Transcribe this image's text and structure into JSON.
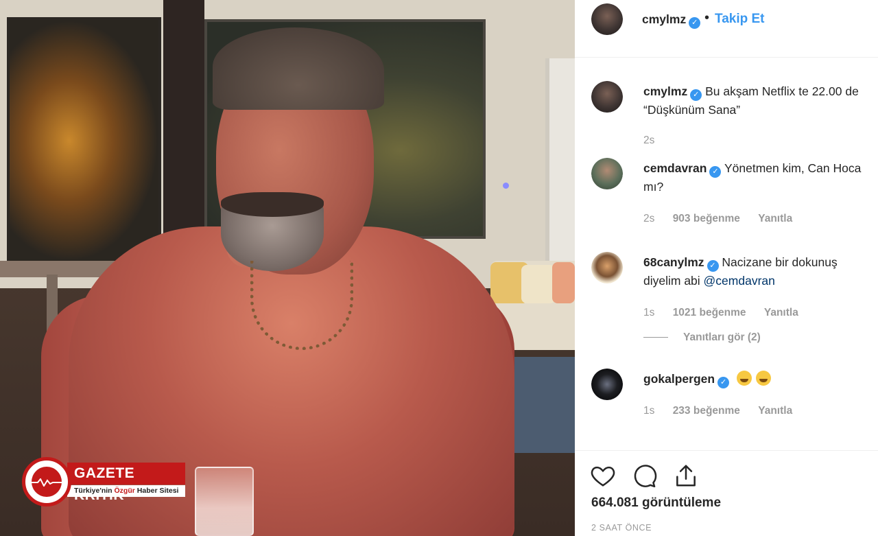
{
  "watermark": {
    "brand": "GAZETE KRITIK",
    "tagline_part1": "Türkiye'nin ",
    "tagline_highlight": "Özgür",
    "tagline_part2": " Haber Sitesi"
  },
  "header": {
    "username": "cmylmz",
    "bullet": "•",
    "follow_label": "Takip Et"
  },
  "caption": {
    "username": "cmylmz",
    "text": "Bu akşam Netflix te 22.00 de “Düşkünüm Sana”",
    "time": "2s"
  },
  "comments": [
    {
      "username": "cemdavran",
      "text": "Yönetmen kim, Can Hoca mı?",
      "time": "2s",
      "likes": "903 beğenme",
      "reply": "Yanıtla"
    },
    {
      "username": "68canylmz",
      "text": "Nacizane bir dokunuş diyelim abi ",
      "mention": "@cemdavran",
      "time": "1s",
      "likes": "1021 beğenme",
      "reply": "Yanıtla",
      "view_replies": "Yanıtları gör (2)"
    },
    {
      "username": "gokalpergen",
      "time": "1s",
      "likes": "233 beğenme",
      "reply": "Yanıtla"
    }
  ],
  "footer": {
    "views": "664.081 görüntüleme",
    "posted": "2 SAAT ÖNCE"
  },
  "icons": {
    "like": "heart-icon",
    "comment": "comment-icon",
    "share": "share-icon",
    "verified": "verified-badge-icon"
  },
  "colors": {
    "link_blue": "#3897f0",
    "verified_blue": "#3897f0",
    "meta_gray": "#999999",
    "watermark_red": "#c31a1a"
  }
}
